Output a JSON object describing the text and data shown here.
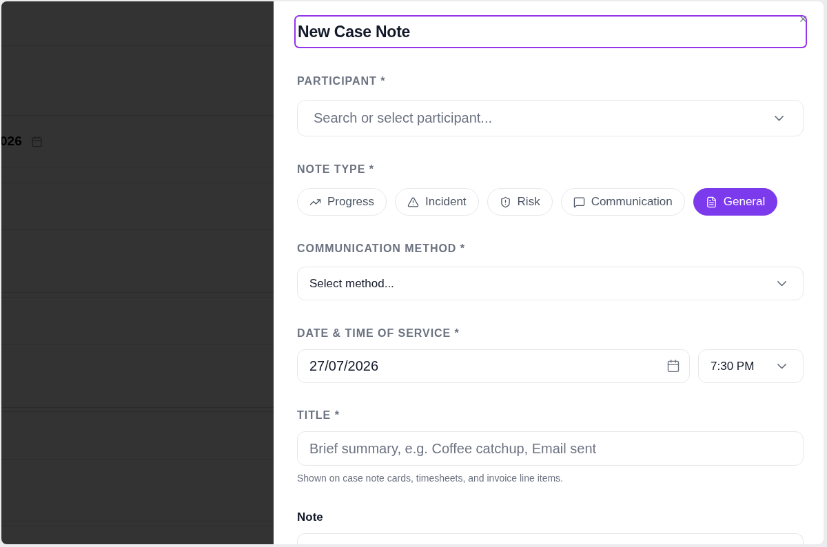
{
  "background_page": {
    "date_fragment": "026"
  },
  "dialog": {
    "title": "New Case Note",
    "title_focused": true,
    "participant": {
      "label": "PARTICIPANT *",
      "placeholder": "Search or select participant..."
    },
    "note_type": {
      "label": "NOTE TYPE *",
      "options": [
        {
          "label": "Progress",
          "selected": false
        },
        {
          "label": "Incident",
          "selected": false
        },
        {
          "label": "Risk",
          "selected": false
        },
        {
          "label": "Communication",
          "selected": false
        },
        {
          "label": "General",
          "selected": true
        }
      ]
    },
    "communication_method": {
      "label": "COMMUNICATION METHOD *",
      "value": "Select method..."
    },
    "date_time": {
      "label": "DATE & TIME OF SERVICE *",
      "date": "27/07/2026",
      "time": "7:30 PM"
    },
    "title_field": {
      "label": "TITLE *",
      "placeholder": "Brief summary, e.g. Coffee catchup, Email sent",
      "help": "Shown on case note cards, timesheets, and invoice line items."
    },
    "note": {
      "label": "Note"
    }
  }
}
